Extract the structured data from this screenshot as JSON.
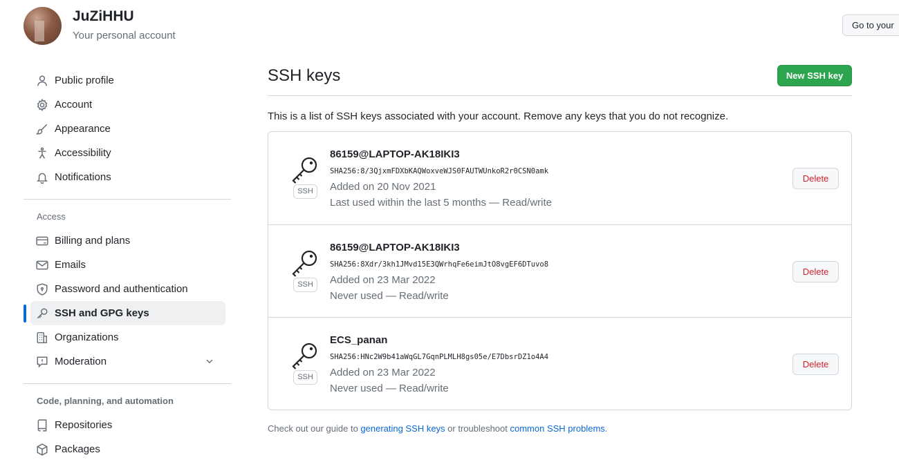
{
  "account": {
    "name": "JuZiHHU",
    "subtitle": "Your personal account",
    "goto_label": "Go to your"
  },
  "sidebar": {
    "items": [
      {
        "label": "Public profile",
        "icon": "person-icon"
      },
      {
        "label": "Account",
        "icon": "gear-icon"
      },
      {
        "label": "Appearance",
        "icon": "paintbrush-icon"
      },
      {
        "label": "Accessibility",
        "icon": "accessibility-icon"
      },
      {
        "label": "Notifications",
        "icon": "bell-icon"
      }
    ],
    "access_heading": "Access",
    "access_items": [
      {
        "label": "Billing and plans",
        "icon": "credit-card-icon"
      },
      {
        "label": "Emails",
        "icon": "mail-icon"
      },
      {
        "label": "Password and authentication",
        "icon": "shield-lock-icon"
      },
      {
        "label": "SSH and GPG keys",
        "icon": "key-icon",
        "active": true
      },
      {
        "label": "Organizations",
        "icon": "organization-icon"
      },
      {
        "label": "Moderation",
        "icon": "report-icon"
      }
    ],
    "code_heading": "Code, planning, and automation",
    "code_items": [
      {
        "label": "Repositories",
        "icon": "repo-icon"
      },
      {
        "label": "Packages",
        "icon": "package-icon"
      }
    ]
  },
  "main": {
    "title": "SSH keys",
    "new_button": "New SSH key",
    "intro": "This is a list of SSH keys associated with your account. Remove any keys that you do not recognize.",
    "keys": [
      {
        "title": "86159@LAPTOP-AK18IKI3",
        "fingerprint": "SHA256:8/3QjxmFDXbKAQWoxveWJS0FAUTWUnkoR2r0CSN0amk",
        "added": "Added on 20 Nov 2021",
        "used": "Last used within the last 5 months — Read/write",
        "badge": "SSH",
        "delete": "Delete"
      },
      {
        "title": "86159@LAPTOP-AK18IKI3",
        "fingerprint": "SHA256:8Xdr/3kh1JMvd15E3QWrhqFe6eimJtO8vgEF6DTuvo8",
        "added": "Added on 23 Mar 2022",
        "used": "Never used — Read/write",
        "badge": "SSH",
        "delete": "Delete"
      },
      {
        "title": "ECS_panan",
        "fingerprint": "SHA256:HNc2W9b41aWqGL7GqnPLMLH8gs05e/E7DbsrDZ1o4A4",
        "added": "Added on 23 Mar 2022",
        "used": "Never used — Read/write",
        "badge": "SSH",
        "delete": "Delete"
      }
    ],
    "footer": {
      "pre": "Check out our guide to ",
      "link1": "generating SSH keys",
      "mid": " or troubleshoot ",
      "link2": "common SSH problems",
      "post": "."
    }
  },
  "colors": {
    "accent": "#0969da",
    "primary_button": "#2da44e",
    "danger": "#cf222e"
  }
}
